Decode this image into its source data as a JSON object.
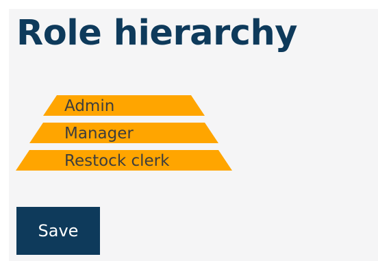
{
  "page": {
    "title": "Role hierarchy"
  },
  "hierarchy": {
    "roles": [
      {
        "label": "Admin"
      },
      {
        "label": "Manager"
      },
      {
        "label": "Restock clerk"
      }
    ]
  },
  "actions": {
    "save_label": "Save"
  },
  "colors": {
    "tier_fill": "#ffa500",
    "title": "#0e3a5b",
    "button": "#0e3a5b",
    "panel": "#f5f5f6"
  }
}
